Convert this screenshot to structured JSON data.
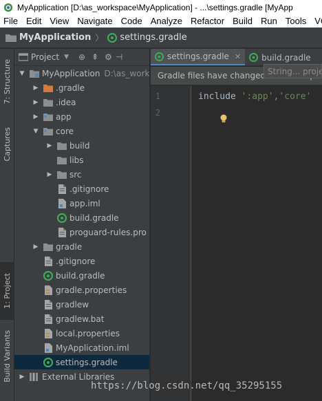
{
  "window": {
    "title": "MyApplication [D:\\as_workspace\\MyApplication] - ...\\settings.gradle [MyApp"
  },
  "menu": [
    "File",
    "Edit",
    "View",
    "Navigate",
    "Code",
    "Analyze",
    "Refactor",
    "Build",
    "Run",
    "Tools",
    "VC"
  ],
  "breadcrumb": {
    "project": "MyApplication",
    "file": "settings.gradle"
  },
  "left_strip": {
    "structure": "7: Structure",
    "captures": "Captures",
    "project": "1: Project",
    "build_variants": "Build Variants"
  },
  "project_panel": {
    "title": "Project",
    "tree": [
      {
        "label": "MyApplication",
        "hint": "D:\\as_work",
        "arrow": "down",
        "icon": "module-icon",
        "depth": 0
      },
      {
        "label": ".gradle",
        "arrow": "right",
        "icon": "folder-orange-icon",
        "depth": 1
      },
      {
        "label": ".idea",
        "arrow": "right",
        "icon": "folder-icon",
        "depth": 1
      },
      {
        "label": "app",
        "arrow": "right",
        "icon": "module-folder-icon",
        "depth": 1
      },
      {
        "label": "core",
        "arrow": "down",
        "icon": "module-folder-icon",
        "depth": 1
      },
      {
        "label": "build",
        "arrow": "right",
        "icon": "folder-icon",
        "depth": 2
      },
      {
        "label": "libs",
        "arrow": "",
        "icon": "folder-icon",
        "depth": 2
      },
      {
        "label": "src",
        "arrow": "right",
        "icon": "folder-icon",
        "depth": 2
      },
      {
        "label": ".gitignore",
        "arrow": "",
        "icon": "file-icon",
        "depth": 2
      },
      {
        "label": "app.iml",
        "arrow": "",
        "icon": "iml-file-icon",
        "depth": 2
      },
      {
        "label": "build.gradle",
        "arrow": "",
        "icon": "gradle-icon",
        "depth": 2
      },
      {
        "label": "proguard-rules.pro",
        "arrow": "",
        "icon": "file-icon",
        "depth": 2
      },
      {
        "label": "gradle",
        "arrow": "right",
        "icon": "folder-icon",
        "depth": 1
      },
      {
        "label": ".gitignore",
        "arrow": "",
        "icon": "file-icon",
        "depth": 1
      },
      {
        "label": "build.gradle",
        "arrow": "",
        "icon": "gradle-icon",
        "depth": 1
      },
      {
        "label": "gradle.properties",
        "arrow": "",
        "icon": "properties-icon",
        "depth": 1
      },
      {
        "label": "gradlew",
        "arrow": "",
        "icon": "file-icon",
        "depth": 1
      },
      {
        "label": "gradlew.bat",
        "arrow": "",
        "icon": "file-icon",
        "depth": 1
      },
      {
        "label": "local.properties",
        "arrow": "",
        "icon": "properties-icon",
        "depth": 1
      },
      {
        "label": "MyApplication.iml",
        "arrow": "",
        "icon": "iml-file-icon",
        "depth": 1
      },
      {
        "label": "settings.gradle",
        "arrow": "",
        "icon": "gradle-icon",
        "depth": 1,
        "selected": true
      },
      {
        "label": "External Libraries",
        "arrow": "right",
        "icon": "libraries-icon",
        "depth": 0
      }
    ]
  },
  "editor": {
    "tabs": [
      {
        "label": "settings.gradle",
        "active": true
      },
      {
        "label": "build.gradle",
        "active": false
      }
    ],
    "notification": "Gradle files have changed since last project sync",
    "tooltip": "String... project",
    "line_numbers": [
      "1",
      "2"
    ],
    "code": {
      "keyword": "include",
      "arg1": "':app'",
      "comma": ",",
      "arg2": "'core'"
    }
  },
  "watermark": "https://blog.csdn.net/qq_35295155",
  "colors": {
    "panel_bg": "#3c3f41",
    "editor_bg": "#2b2b2b",
    "selection": "#0d293e",
    "string": "#6a8759",
    "gradle_green": "#3daa58",
    "folder": "#8c8f92",
    "orange_folder": "#d47b3b"
  }
}
